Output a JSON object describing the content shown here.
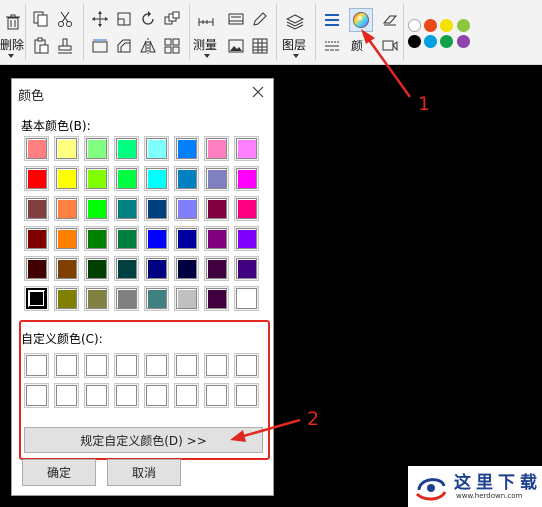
{
  "toolbar": {
    "delete_label": "删除",
    "measure_label": "测量",
    "layers_label": "图层",
    "color_label_partial": "颜",
    "palette_dots_row1": [
      "#ffffff",
      "#e84a1c",
      "#f2e400",
      "#8cc63f"
    ],
    "palette_dots_row2": [
      "#000000",
      "#00a1e0",
      "#12a34a",
      "#8f44ad"
    ]
  },
  "dialog": {
    "title": "颜色",
    "basic_colors_label": "基本颜色(B):",
    "basic_colors": [
      [
        "#ff8080",
        "#ffff80",
        "#80ff80",
        "#00ff80",
        "#80ffff",
        "#0080ff",
        "#ff80c0",
        "#ff80ff"
      ],
      [
        "#ff0000",
        "#ffff00",
        "#80ff00",
        "#00ff40",
        "#00ffff",
        "#0080c0",
        "#8080c0",
        "#ff00ff"
      ],
      [
        "#804040",
        "#ff8040",
        "#00ff00",
        "#008080",
        "#004080",
        "#8080ff",
        "#800040",
        "#ff0080"
      ],
      [
        "#800000",
        "#ff8000",
        "#008000",
        "#008040",
        "#0000ff",
        "#0000a0",
        "#800080",
        "#8000ff"
      ],
      [
        "#400000",
        "#804000",
        "#004000",
        "#004040",
        "#000080",
        "#000040",
        "#400040",
        "#400080"
      ],
      [
        "#000000",
        "#808000",
        "#808040",
        "#808080",
        "#408080",
        "#c0c0c0",
        "#400040",
        "#ffffff"
      ]
    ],
    "custom_colors_label": "自定义颜色(C):",
    "define_custom_button": "规定自定义颜色(D) >>",
    "ok_button": "确定",
    "cancel_button": "取消"
  },
  "annotations": {
    "marker_1": "1",
    "marker_2": "2",
    "color": "#e0281f"
  },
  "watermark": {
    "title": "这里下载",
    "url": "www.herdown.com"
  }
}
